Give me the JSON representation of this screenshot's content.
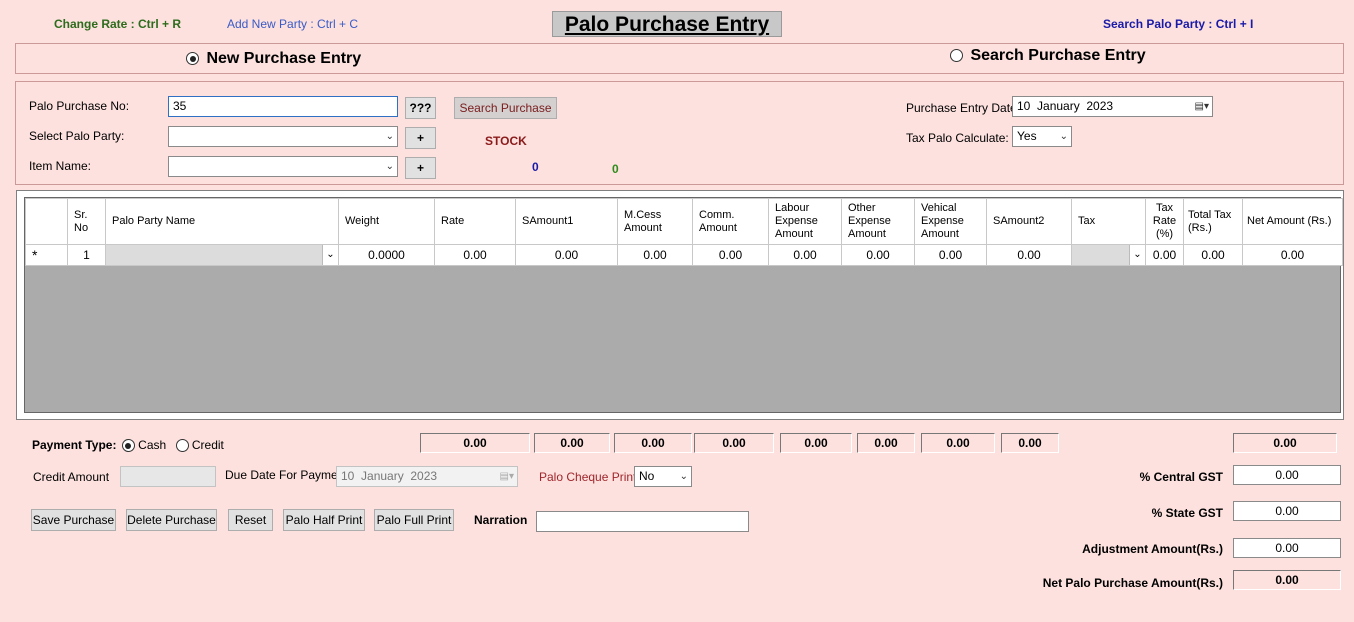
{
  "hotkeys": {
    "change_rate": "Change Rate : Ctrl + R",
    "add_party": "Add New Party : Ctrl + C",
    "search_party": "Search Palo Party : Ctrl + I"
  },
  "colors": {
    "change_rate": "#2e6b1c",
    "add_party": "#3a5bc7",
    "search_party": "#1a1aa8",
    "stock": "#8b1a1a"
  },
  "title": "Palo Purchase Entry",
  "mode": {
    "new_label": "New Purchase Entry",
    "search_label": "Search Purchase Entry",
    "selected": "new"
  },
  "form": {
    "purchase_no_label": "Palo Purchase No:",
    "purchase_no_value": "35",
    "qq_button": "???",
    "search_button": "Search Purchase",
    "party_label": "Select Palo Party:",
    "party_value": "",
    "item_label": "Item Name:",
    "item_value": "",
    "plus": "+",
    "stock_label": "STOCK",
    "stock_value_1": "0",
    "stock_value_2": "0",
    "entry_date_label": "Purchase Entry Date:",
    "entry_date_value": "10  January  2023",
    "tax_calc_label": "Tax Palo Calculate:",
    "tax_calc_value": "Yes"
  },
  "grid": {
    "headers": [
      "",
      "Sr.\nNo",
      "Palo Party Name",
      "Weight",
      "Rate",
      "SAmount1",
      "M.Cess\nAmount",
      "Comm.\nAmount",
      "Labour\nExpense\nAmount",
      "Other\nExpense\nAmount",
      "Vehical\nExpense\nAmount",
      "SAmount2",
      "Tax",
      "Tax\nRate\n(%)",
      "Total Tax\n(Rs.)",
      "Net Amount (Rs.)"
    ],
    "row": [
      "*",
      "1",
      "",
      "0.0000",
      "0.00",
      "0.00",
      "0.00",
      "0.00",
      "0.00",
      "0.00",
      "0.00",
      "0.00",
      "",
      "0.00",
      "0.00",
      "0.00"
    ]
  },
  "payment": {
    "type_label": "Payment Type:",
    "cash_label": "Cash",
    "credit_label": "Credit",
    "selected": "cash",
    "credit_amount_label": "Credit Amount",
    "credit_amount_value": "",
    "due_date_label": "Due Date For Payment",
    "due_date_value": "10  January  2023",
    "cheque_label": "Palo Cheque Print:",
    "cheque_value": "No"
  },
  "totals": [
    "0.00",
    "0.00",
    "0.00",
    "0.00",
    "0.00",
    "0.00",
    "0.00",
    "0.00",
    "0.00"
  ],
  "buttons": {
    "save": "Save Purchase",
    "delete": "Delete Purchase",
    "reset": "Reset",
    "half_print": "Palo Half Print",
    "full_print": "Palo Full Print"
  },
  "narration": {
    "label": "Narration",
    "value": ""
  },
  "summary": {
    "central_gst_label": "% Central GST",
    "central_gst_value": "0.00",
    "state_gst_label": "% State GST",
    "state_gst_value": "0.00",
    "adjustment_label": "Adjustment Amount(Rs.)",
    "adjustment_value": "0.00",
    "net_label": "Net Palo Purchase Amount(Rs.)",
    "net_value": "0.00"
  }
}
